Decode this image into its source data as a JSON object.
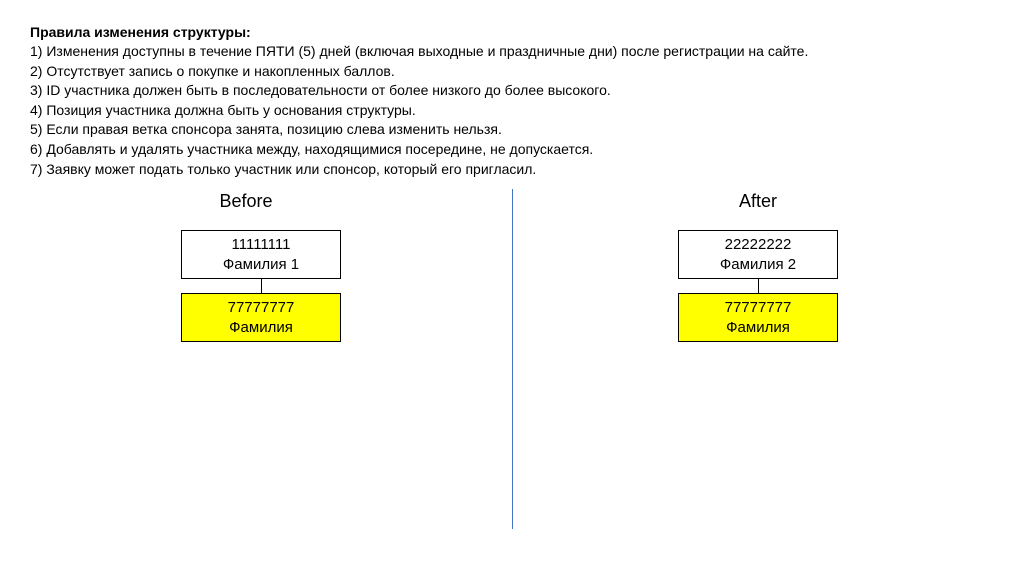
{
  "rules": {
    "title": "Правила изменения структуры:",
    "items": [
      "1) Изменения доступны в течение ПЯТИ (5) дней (включая выходные и праздничные дни) после регистрации на сайте.",
      "2) Отсутствует запись о покупке и накопленных баллов.",
      "3) ID участника должен быть в последовательности от более низкого до более высокого.",
      "4) Позиция участника должна быть у основания структуры.",
      "5) Если правая ветка спонсора занята, позицию слева изменить нельзя.",
      "6) Добавлять и удалять участника между, находящимися посередине, не допускается.",
      "7) Заявку может подать только участник или спонсор, который его пригласил."
    ]
  },
  "diagram": {
    "before": {
      "title": "Before",
      "parent": {
        "id": "11111111",
        "name": "Фамилия 1"
      },
      "child": {
        "id": "77777777",
        "name": "Фамилия"
      }
    },
    "after": {
      "title": "After",
      "parent": {
        "id": "22222222",
        "name": "Фамилия 2"
      },
      "child": {
        "id": "77777777",
        "name": "Фамилия"
      }
    }
  }
}
